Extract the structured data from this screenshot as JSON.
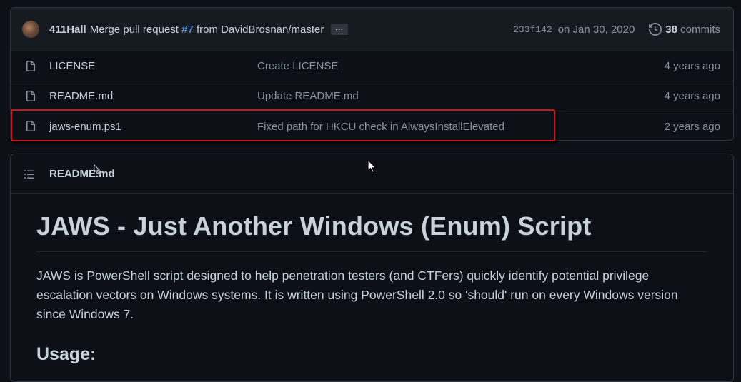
{
  "commit": {
    "author": "411Hall",
    "message_prefix": "Merge pull request",
    "pr_link": "#7",
    "message_suffix": "from DavidBrosnan/master",
    "ellipsis": "...",
    "sha": "233f142",
    "date": "on Jan 30, 2020",
    "commit_count": "38",
    "commits_label": "commits"
  },
  "files": [
    {
      "name": "LICENSE",
      "message": "Create LICENSE",
      "age": "4 years ago"
    },
    {
      "name": "README.md",
      "message": "Update README.md",
      "age": "4 years ago"
    },
    {
      "name": "jaws-enum.ps1",
      "message": "Fixed path for HKCU check in AlwaysInstallElevated",
      "age": "2 years ago"
    }
  ],
  "readme": {
    "filename": "README.md",
    "title": "JAWS - Just Another Windows (Enum) Script",
    "paragraph": "JAWS is PowerShell script designed to help penetration testers (and CTFers) quickly identify potential privilege escalation vectors on Windows systems. It is written using PowerShell 2.0 so 'should' run on every Windows version since Windows 7.",
    "usage_heading": "Usage:"
  },
  "colors": {
    "background": "#0d1117",
    "header_bg": "#161b22",
    "border": "#30363d",
    "link": "#58a6ff",
    "highlight": "#d1151c"
  },
  "icons": [
    "avatar",
    "history-icon",
    "file-icon",
    "list-icon",
    "mouse-cursor-icon"
  ]
}
